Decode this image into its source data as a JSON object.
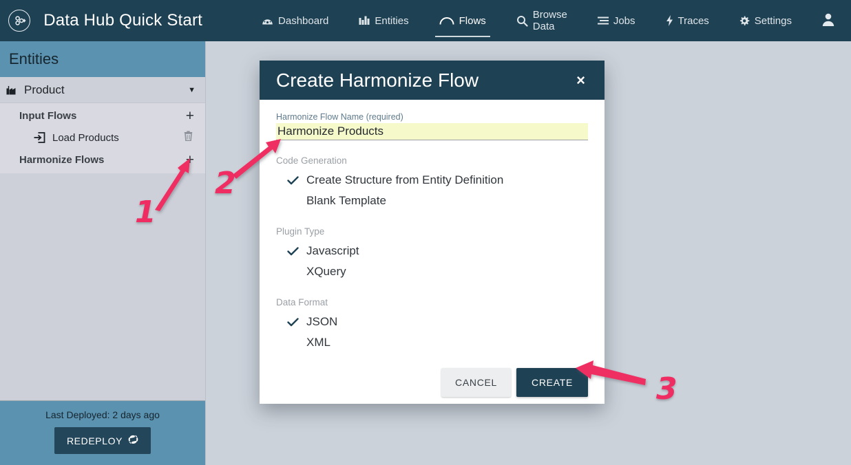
{
  "header": {
    "logo_icon": "molecule-logo-icon",
    "app_title": "Data Hub Quick Start",
    "nav_items": [
      {
        "label": "Dashboard",
        "icon": "dashboard-icon",
        "active": false
      },
      {
        "label": "Entities",
        "icon": "entities-chart-icon",
        "active": false
      },
      {
        "label": "Flows",
        "icon": "flows-arc-icon",
        "active": true
      },
      {
        "label": "Browse Data",
        "icon": "search-icon",
        "active": false
      },
      {
        "label": "Jobs",
        "icon": "jobs-list-icon",
        "active": false
      },
      {
        "label": "Traces",
        "icon": "traces-bolt-icon",
        "active": false
      },
      {
        "label": "Settings",
        "icon": "gear-icon",
        "active": false
      }
    ],
    "account_icon": "user-avatar-icon"
  },
  "sidebar": {
    "title": "Entities",
    "entity": {
      "name": "Product",
      "icon": "industry-icon",
      "caret_icon": "chevron-down-icon"
    },
    "groups": [
      {
        "label": "Input Flows",
        "add_icon": "plus-icon",
        "items": [
          {
            "label": "Load Products",
            "icon": "sign-in-icon",
            "delete_icon": "trash-icon"
          }
        ]
      },
      {
        "label": "Harmonize Flows",
        "add_icon": "plus-icon",
        "items": []
      }
    ],
    "footer": {
      "last_deployed": "Last Deployed: 2 days ago",
      "redeploy_label": "REDEPLOY",
      "redeploy_icon": "refresh-icon"
    }
  },
  "modal": {
    "title": "Create Harmonize Flow",
    "close_icon": "close-icon",
    "name_field": {
      "label": "Harmonize Flow Name (required)",
      "value": "Harmonize Products",
      "placeholder": ""
    },
    "sections": [
      {
        "title": "Code Generation",
        "options": [
          {
            "label": "Create Structure from Entity Definition",
            "selected": true
          },
          {
            "label": "Blank Template",
            "selected": false
          }
        ]
      },
      {
        "title": "Plugin Type",
        "options": [
          {
            "label": "Javascript",
            "selected": true
          },
          {
            "label": "XQuery",
            "selected": false
          }
        ]
      },
      {
        "title": "Data Format",
        "options": [
          {
            "label": "JSON",
            "selected": true
          },
          {
            "label": "XML",
            "selected": false
          }
        ]
      }
    ],
    "cancel_label": "CANCEL",
    "create_label": "CREATE"
  },
  "annotations": {
    "color": "#ef2d62",
    "markers": [
      {
        "number": "1",
        "target": "harmonize-flows-add-button"
      },
      {
        "number": "2",
        "target": "harmonize-flow-name-input"
      },
      {
        "number": "3",
        "target": "create-button"
      }
    ]
  },
  "colors": {
    "navy": "#1f4154",
    "steel_blue": "#5a92b0",
    "canvas": "#ccd2da",
    "autofill_yellow": "#f6f9c9",
    "accent_pink": "#ef2d62"
  }
}
